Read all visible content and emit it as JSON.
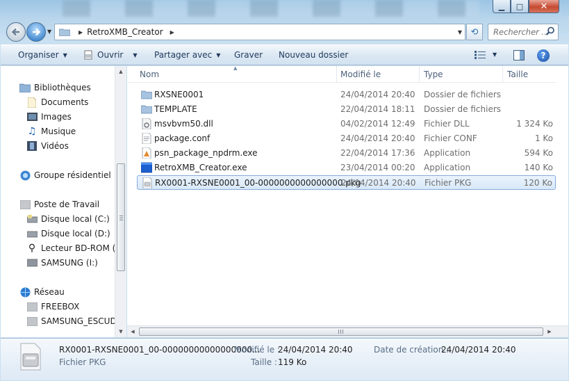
{
  "window": {
    "minimize_icon": "minimize-icon",
    "maximize_icon": "maximize-icon",
    "close_icon": "close-icon"
  },
  "navbar": {
    "address_crumb": "RetroXMB_Creator",
    "search_placeholder": "Rechercher ..."
  },
  "toolbar": {
    "organise": "Organiser",
    "open": "Ouvrir",
    "share": "Partager avec",
    "burn": "Graver",
    "new_folder": "Nouveau dossier"
  },
  "sidebar": {
    "groups": [
      {
        "label": "Bibliothèques",
        "icon": "libraries-icon",
        "items": [
          {
            "label": "Documents",
            "icon": "documents-icon"
          },
          {
            "label": "Images",
            "icon": "pictures-icon"
          },
          {
            "label": "Musique",
            "icon": "music-icon"
          },
          {
            "label": "Vidéos",
            "icon": "videos-icon"
          }
        ]
      },
      {
        "label": "Groupe résidentiel",
        "icon": "homegroup-icon",
        "items": []
      },
      {
        "label": "Poste de Travail",
        "icon": "computer-icon",
        "items": [
          {
            "label": "Disque local (C:)",
            "icon": "drive-icon"
          },
          {
            "label": "Disque local (D:)",
            "icon": "drive-icon"
          },
          {
            "label": "Lecteur BD-ROM (F:",
            "icon": "optical-drive-icon"
          },
          {
            "label": "SAMSUNG (I:)",
            "icon": "usb-drive-icon"
          }
        ]
      },
      {
        "label": "Réseau",
        "icon": "network-icon",
        "items": [
          {
            "label": "FREEBOX",
            "icon": "network-computer-icon"
          },
          {
            "label": "SAMSUNG_ESCUDO",
            "icon": "network-computer-icon"
          }
        ]
      }
    ]
  },
  "columns": {
    "name": "Nom",
    "modified": "Modifié le",
    "type": "Type",
    "size": "Taille"
  },
  "files": [
    {
      "name": "RXSNE0001",
      "modified": "24/04/2014 20:40",
      "type": "Dossier de fichiers",
      "size": "",
      "icon": "folder-icon"
    },
    {
      "name": "TEMPLATE",
      "modified": "22/04/2014 18:11",
      "type": "Dossier de fichiers",
      "size": "",
      "icon": "folder-icon"
    },
    {
      "name": "msvbvm50.dll",
      "modified": "04/02/2014 12:49",
      "type": "Fichier DLL",
      "size": "1 324 Ko",
      "icon": "dll-file-icon"
    },
    {
      "name": "package.conf",
      "modified": "24/04/2014 20:40",
      "type": "Fichier CONF",
      "size": "1 Ko",
      "icon": "text-file-icon"
    },
    {
      "name": "psn_package_npdrm.exe",
      "modified": "22/04/2014 17:36",
      "type": "Application",
      "size": "594 Ko",
      "icon": "exe-file-icon"
    },
    {
      "name": "RetroXMB_Creator.exe",
      "modified": "23/04/2014 00:20",
      "type": "Application",
      "size": "140 Ko",
      "icon": "app-window-icon"
    },
    {
      "name": "RX0001-RXSNE0001_00-0000000000000000.pkg",
      "modified": "24/04/2014 20:40",
      "type": "Fichier PKG",
      "size": "120 Ko",
      "icon": "pkg-file-icon",
      "selected": true
    }
  ],
  "details": {
    "name": "RX0001-RXSNE0001_00-00000000000000000...",
    "type": "Fichier PKG",
    "modified_label": "Modifié le :",
    "modified_value": "24/04/2014 20:40",
    "size_label": "Taille :",
    "size_value": "119 Ko",
    "created_label": "Date de création :",
    "created_value": "24/04/2014 20:40"
  },
  "colors": {
    "selection": "#d8e9f9",
    "toolbar_text": "#1e395b",
    "link_blue": "#1e6fbf"
  }
}
